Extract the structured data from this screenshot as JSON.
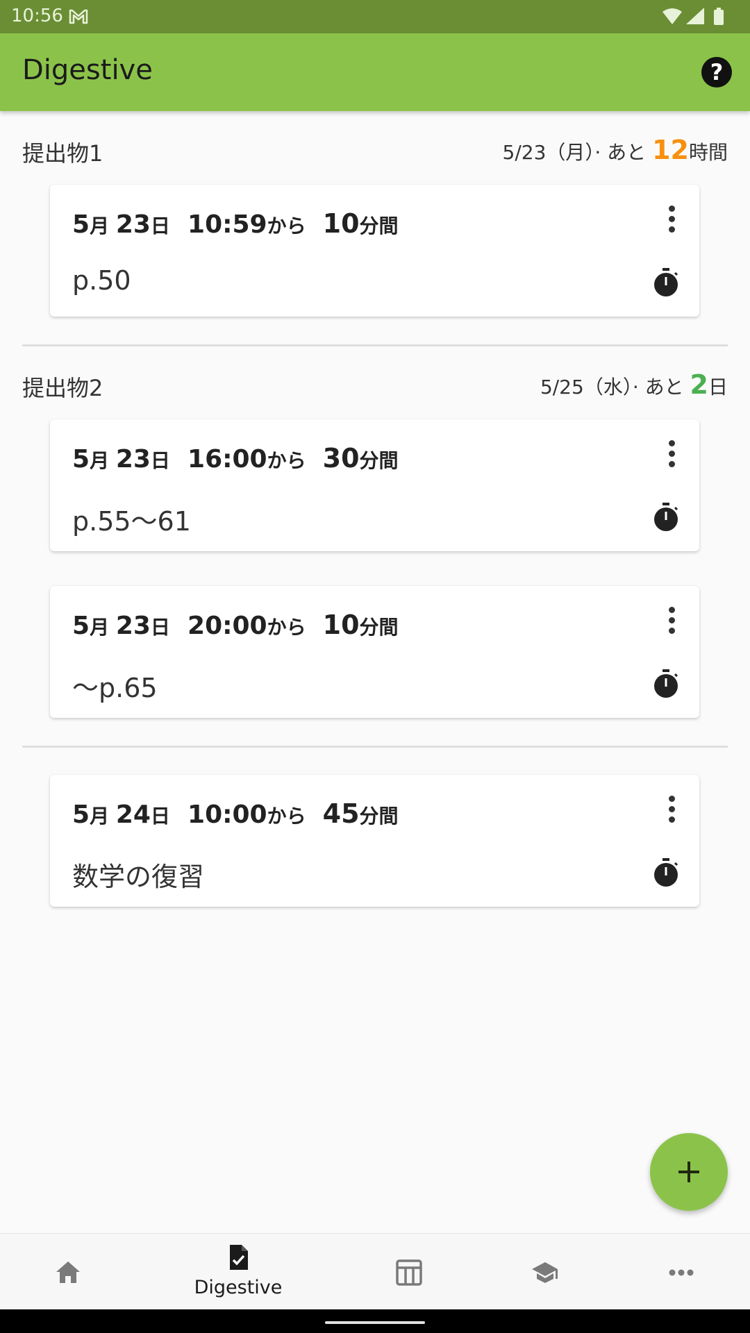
{
  "status_bar": {
    "time": "10:56"
  },
  "app_bar": {
    "title": "Digestive",
    "help_icon": "help-circle-icon",
    "help_glyph": "?"
  },
  "groups": [
    {
      "title": "提出物1",
      "due_date": "5/23（月）· あと ",
      "due_count": "12",
      "due_unit": "時間",
      "due_color": "#f7900f"
    },
    {
      "title": "提出物2",
      "due_date": "5/25（水）· あと ",
      "due_count": "2",
      "due_unit": "日",
      "due_color": "#4caf50"
    }
  ],
  "cards": [
    {
      "month": "5",
      "day": "23",
      "time": "10:59",
      "duration": "10",
      "note": "p.50"
    },
    {
      "month": "5",
      "day": "23",
      "time": "16:00",
      "duration": "30",
      "note": "p.55〜61"
    },
    {
      "month": "5",
      "day": "23",
      "time": "20:00",
      "duration": "10",
      "note": "〜p.65"
    },
    {
      "month": "5",
      "day": "24",
      "time": "10:00",
      "duration": "45",
      "note": "数学の復習"
    }
  ],
  "labels": {
    "month_suffix": "月 ",
    "day_suffix": "日",
    "from_suffix": "から",
    "minutes_suffix": "分間"
  },
  "fab": {
    "icon": "plus-icon"
  },
  "bottom_nav": {
    "items": [
      {
        "icon": "home-icon",
        "label": ""
      },
      {
        "icon": "assignment-check-icon",
        "label": "Digestive",
        "selected": true
      },
      {
        "icon": "timetable-icon",
        "label": ""
      },
      {
        "icon": "school-cap-icon",
        "label": ""
      },
      {
        "icon": "more-horizontal-icon",
        "label": ""
      }
    ]
  },
  "colors": {
    "app_bar": "#8bc34a",
    "status_bar": "#6b8e35",
    "accent_orange": "#f7900f",
    "accent_green": "#4caf50"
  }
}
